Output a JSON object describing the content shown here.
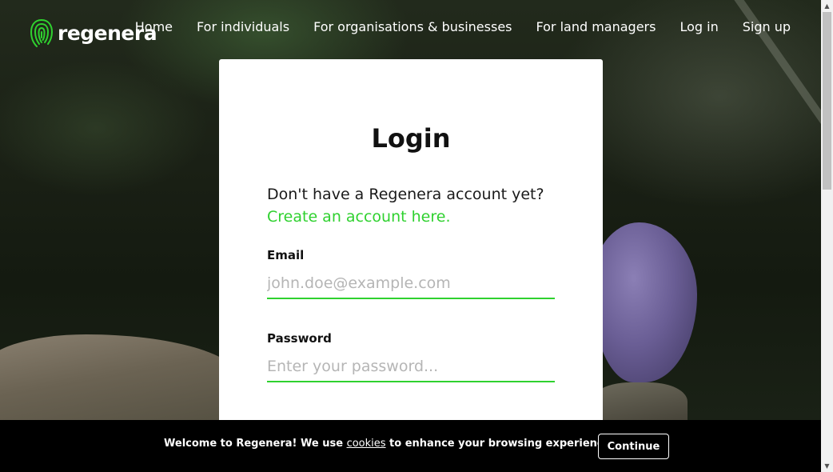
{
  "brand": {
    "name": "regenera",
    "accent": "#2fd12f",
    "logo_icon": "fingerprint-icon"
  },
  "nav": {
    "links": [
      "Home",
      "For individuals",
      "For organisations & businesses",
      "For land managers",
      "Log in",
      "Sign up"
    ]
  },
  "login": {
    "title": "Login",
    "prompt": "Don't have a Regenera account yet?",
    "create_link": "Create an account here.",
    "email_label": "Email",
    "email_placeholder": "john.doe@example.com",
    "password_label": "Password",
    "password_placeholder": "Enter your password..."
  },
  "cookie_bar": {
    "text_before": "Welcome to Regenera! We use ",
    "link": "cookies",
    "text_after": " to enhance your browsing experience.",
    "button": "Continue"
  },
  "scrollbar": {
    "up_icon": "arrow-up-icon",
    "down_icon": "arrow-down-icon"
  }
}
